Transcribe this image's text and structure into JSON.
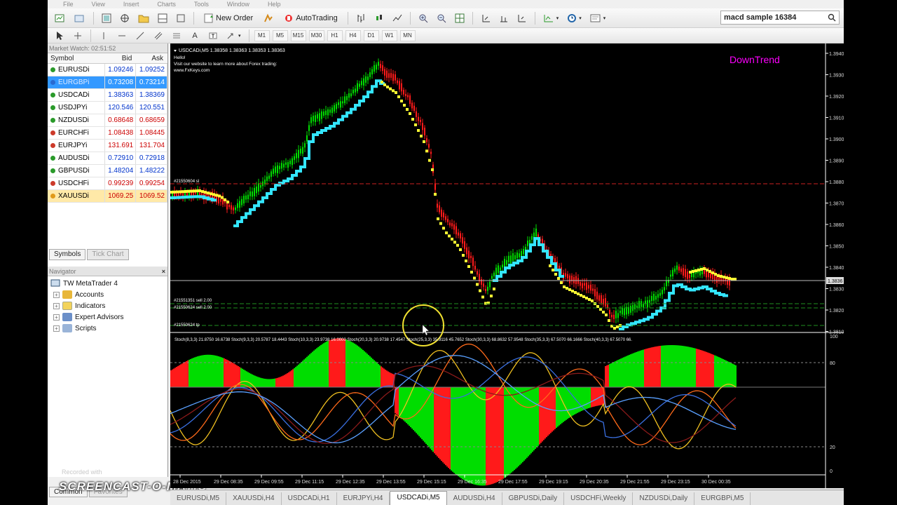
{
  "menu": [
    "File",
    "View",
    "Insert",
    "Charts",
    "Tools",
    "Window",
    "Help"
  ],
  "toolbar": {
    "new_order": "New Order",
    "auto_trading": "AutoTrading",
    "search_value": "macd sample 16384"
  },
  "timeframes": [
    "M1",
    "M5",
    "M15",
    "M30",
    "H1",
    "H4",
    "D1",
    "W1",
    "MN"
  ],
  "market_watch": {
    "title": "Market Watch: 02:51:52",
    "headers": {
      "symbol": "Symbol",
      "bid": "Bid",
      "ask": "Ask"
    },
    "rows": [
      {
        "symbol": "EURUSDi",
        "bid": "1.09246",
        "ask": "1.09252"
      },
      {
        "symbol": "EURGBPi",
        "bid": "0.73208",
        "ask": "0.73214"
      },
      {
        "symbol": "USDCADi",
        "bid": "1.38363",
        "ask": "1.38369"
      },
      {
        "symbol": "USDJPYi",
        "bid": "120.546",
        "ask": "120.551"
      },
      {
        "symbol": "NZDUSDi",
        "bid": "0.68648",
        "ask": "0.68659"
      },
      {
        "symbol": "EURCHFi",
        "bid": "1.08438",
        "ask": "1.08445"
      },
      {
        "symbol": "EURJPYi",
        "bid": "131.691",
        "ask": "131.704"
      },
      {
        "symbol": "AUDUSDi",
        "bid": "0.72910",
        "ask": "0.72918"
      },
      {
        "symbol": "GBPUSDi",
        "bid": "1.48204",
        "ask": "1.48222"
      },
      {
        "symbol": "USDCHFi",
        "bid": "0.99239",
        "ask": "0.99254"
      },
      {
        "symbol": "XAUUSDi",
        "bid": "1069.25",
        "ask": "1069.52"
      }
    ],
    "tabs": [
      "Symbols",
      "Tick Chart"
    ]
  },
  "navigator": {
    "title": "Navigator",
    "root": "TW MetaTrader 4",
    "items": [
      "Accounts",
      "Indicators",
      "Expert Advisors",
      "Scripts"
    ]
  },
  "chart": {
    "header": "USDCADi,M5  1.38358 1.38363 1.38353 1.38363",
    "hello": "Hello!",
    "line2": "Visit our website to learn more about Forex trading:",
    "line3": "www.FxKeys.com",
    "trend_label": "DownTrend",
    "order_label_1": "#21550604 sl",
    "order_label_2": "#21551351 sell 2.00",
    "order_label_3": "#21550624 sell 2.00",
    "order_label_4": "#21550624 tp",
    "price_axis": [
      "1.3940",
      "1.3930",
      "1.3920",
      "1.3910",
      "1.3900",
      "1.3890",
      "1.3880",
      "1.3870",
      "1.3860",
      "1.3850",
      "1.3840",
      "1.3830",
      "1.3820",
      "1.3810"
    ],
    "current_price": "1.3836",
    "indicator_header": "Stoch(8,3,3) 21.8750 16.6738  Stoch(9,3,3) 20.5787 18.4443  Stoch(10,3,3) 23.9738 16.0000  Stoch(20,3,3) 20.9738 17.4547  Stoch(25,3,3) 35.9116 45.7652  Stoch(30,3,3) 68.8632 57.9548  Stoch(35,3,3) 67.5070 66.1666  Stoch(40,3,3) 67.5070 66.",
    "ind_axis": [
      "100",
      "80",
      "20",
      "0"
    ],
    "time_axis": [
      "28 Dec 2015",
      "29 Dec 08:35",
      "29 Dec 09:55",
      "29 Dec 11:15",
      "29 Dec 12:35",
      "29 Dec 13:55",
      "29 Dec 15:15",
      "29 Dec 16:35",
      "29 Dec 17:55",
      "29 Dec 19:15",
      "29 Dec 20:35",
      "29 Dec 21:55",
      "29 Dec 23:15",
      "30 Dec 00:35"
    ]
  },
  "chart_tabs": [
    "EURUSDi,M5",
    "XAUUSDi,H4",
    "USDCADi,H1",
    "EURJPYi,H4",
    "USDCADi,M5",
    "AUDUSDi,H4",
    "GBPUSDi,Daily",
    "USDCHFi,Weekly",
    "NZDUSDi,Daily",
    "EURGBPi,M5"
  ],
  "active_chart_tab": "USDCADi,M5",
  "bottom_left_tabs": [
    "Common",
    "Favorites"
  ],
  "watermark": "SCREENCAST-O-MATIC",
  "watermark_sub": "Recorded with",
  "colors": {
    "bull_candle": "#00dd00",
    "bear_candle": "#ff1a1a",
    "support_line": "#33e6ff",
    "resistance_dots": "#ffff33",
    "trend_label": "#ff00ff"
  }
}
